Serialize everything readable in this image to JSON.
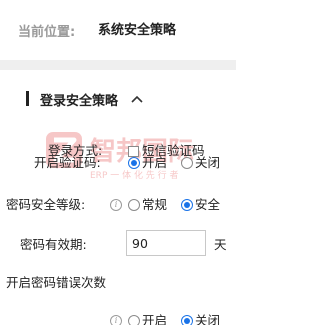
{
  "breadcrumb": {
    "label": "当前位置:",
    "current": "系统安全策略"
  },
  "section": {
    "title": "登录安全策略",
    "collapse_icon": "chevron-up-icon"
  },
  "form": {
    "login_method": {
      "label": "登录方式:",
      "option": "短信验证码",
      "checked": false
    },
    "enable_captcha": {
      "label": "开启验证码:",
      "options": [
        "开启",
        "关闭"
      ],
      "selected": "开启"
    },
    "password_level": {
      "label": "密码安全等级:",
      "options": [
        "常规",
        "安全"
      ],
      "selected": "安全",
      "info_icon": "info-icon"
    },
    "password_validity": {
      "label": "密码有效期:",
      "value": "90",
      "unit": "天"
    },
    "password_error_count": {
      "label": "开启密码错误次数",
      "options": [
        "开启",
        "关闭"
      ],
      "selected": "关闭",
      "info_icon": "info-icon"
    }
  },
  "watermark": {
    "brand": "智邦国际",
    "slogan": "ERP 一 体 化 先 行 者"
  },
  "colors": {
    "accent": "#1a73e8",
    "watermark_red": "#e23a3a",
    "band_gray": "#efefef"
  }
}
